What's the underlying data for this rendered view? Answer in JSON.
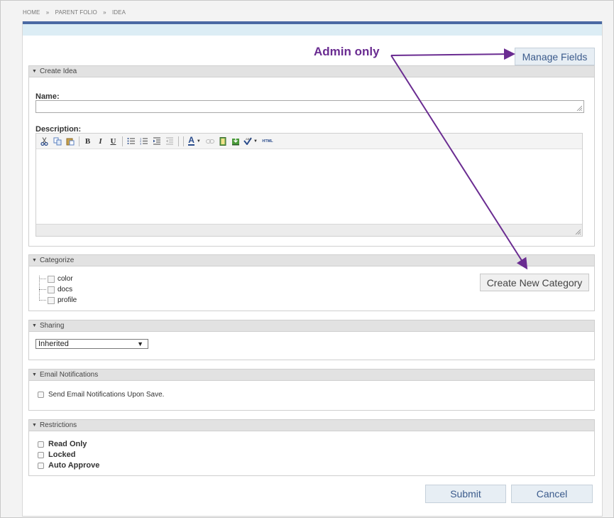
{
  "breadcrumb": [
    "HOME",
    "»",
    "PARENT FOLIO",
    "»",
    "IDEA"
  ],
  "annotation": {
    "text": "Admin only",
    "color": "#6a2c91"
  },
  "manage_fields_label": "Manage Fields",
  "create_idea": {
    "header": "Create Idea",
    "name_label": "Name:",
    "name_value": "",
    "description_label": "Description:",
    "toolbar_icons": [
      "cut-icon",
      "copy-icon",
      "paste-icon",
      "bold-icon",
      "italic-icon",
      "underline-icon",
      "bullet-list-icon",
      "numbered-list-icon",
      "indent-icon",
      "outdent-icon",
      "font-color-icon",
      "link-icon",
      "image-icon",
      "insert-image-icon",
      "spellcheck-icon",
      "html-icon"
    ],
    "toolbar_text": {
      "bold": "B",
      "italic": "I",
      "underline": "U",
      "font_color": "A",
      "html": "HTML"
    }
  },
  "categorize": {
    "header": "Categorize",
    "items": [
      "color",
      "docs",
      "profile"
    ],
    "create_button": "Create New Category"
  },
  "sharing": {
    "header": "Sharing",
    "selected": "Inherited"
  },
  "email": {
    "header": "Email Notifications",
    "option": "Send Email Notifications Upon Save."
  },
  "restrictions": {
    "header": "Restrictions",
    "options": [
      "Read Only",
      "Locked",
      "Auto Approve"
    ]
  },
  "actions": {
    "submit": "Submit",
    "cancel": "Cancel"
  },
  "colors": {
    "accent": "#4a69a3",
    "link": "#3b5b8c",
    "annotation": "#6a2c91"
  }
}
